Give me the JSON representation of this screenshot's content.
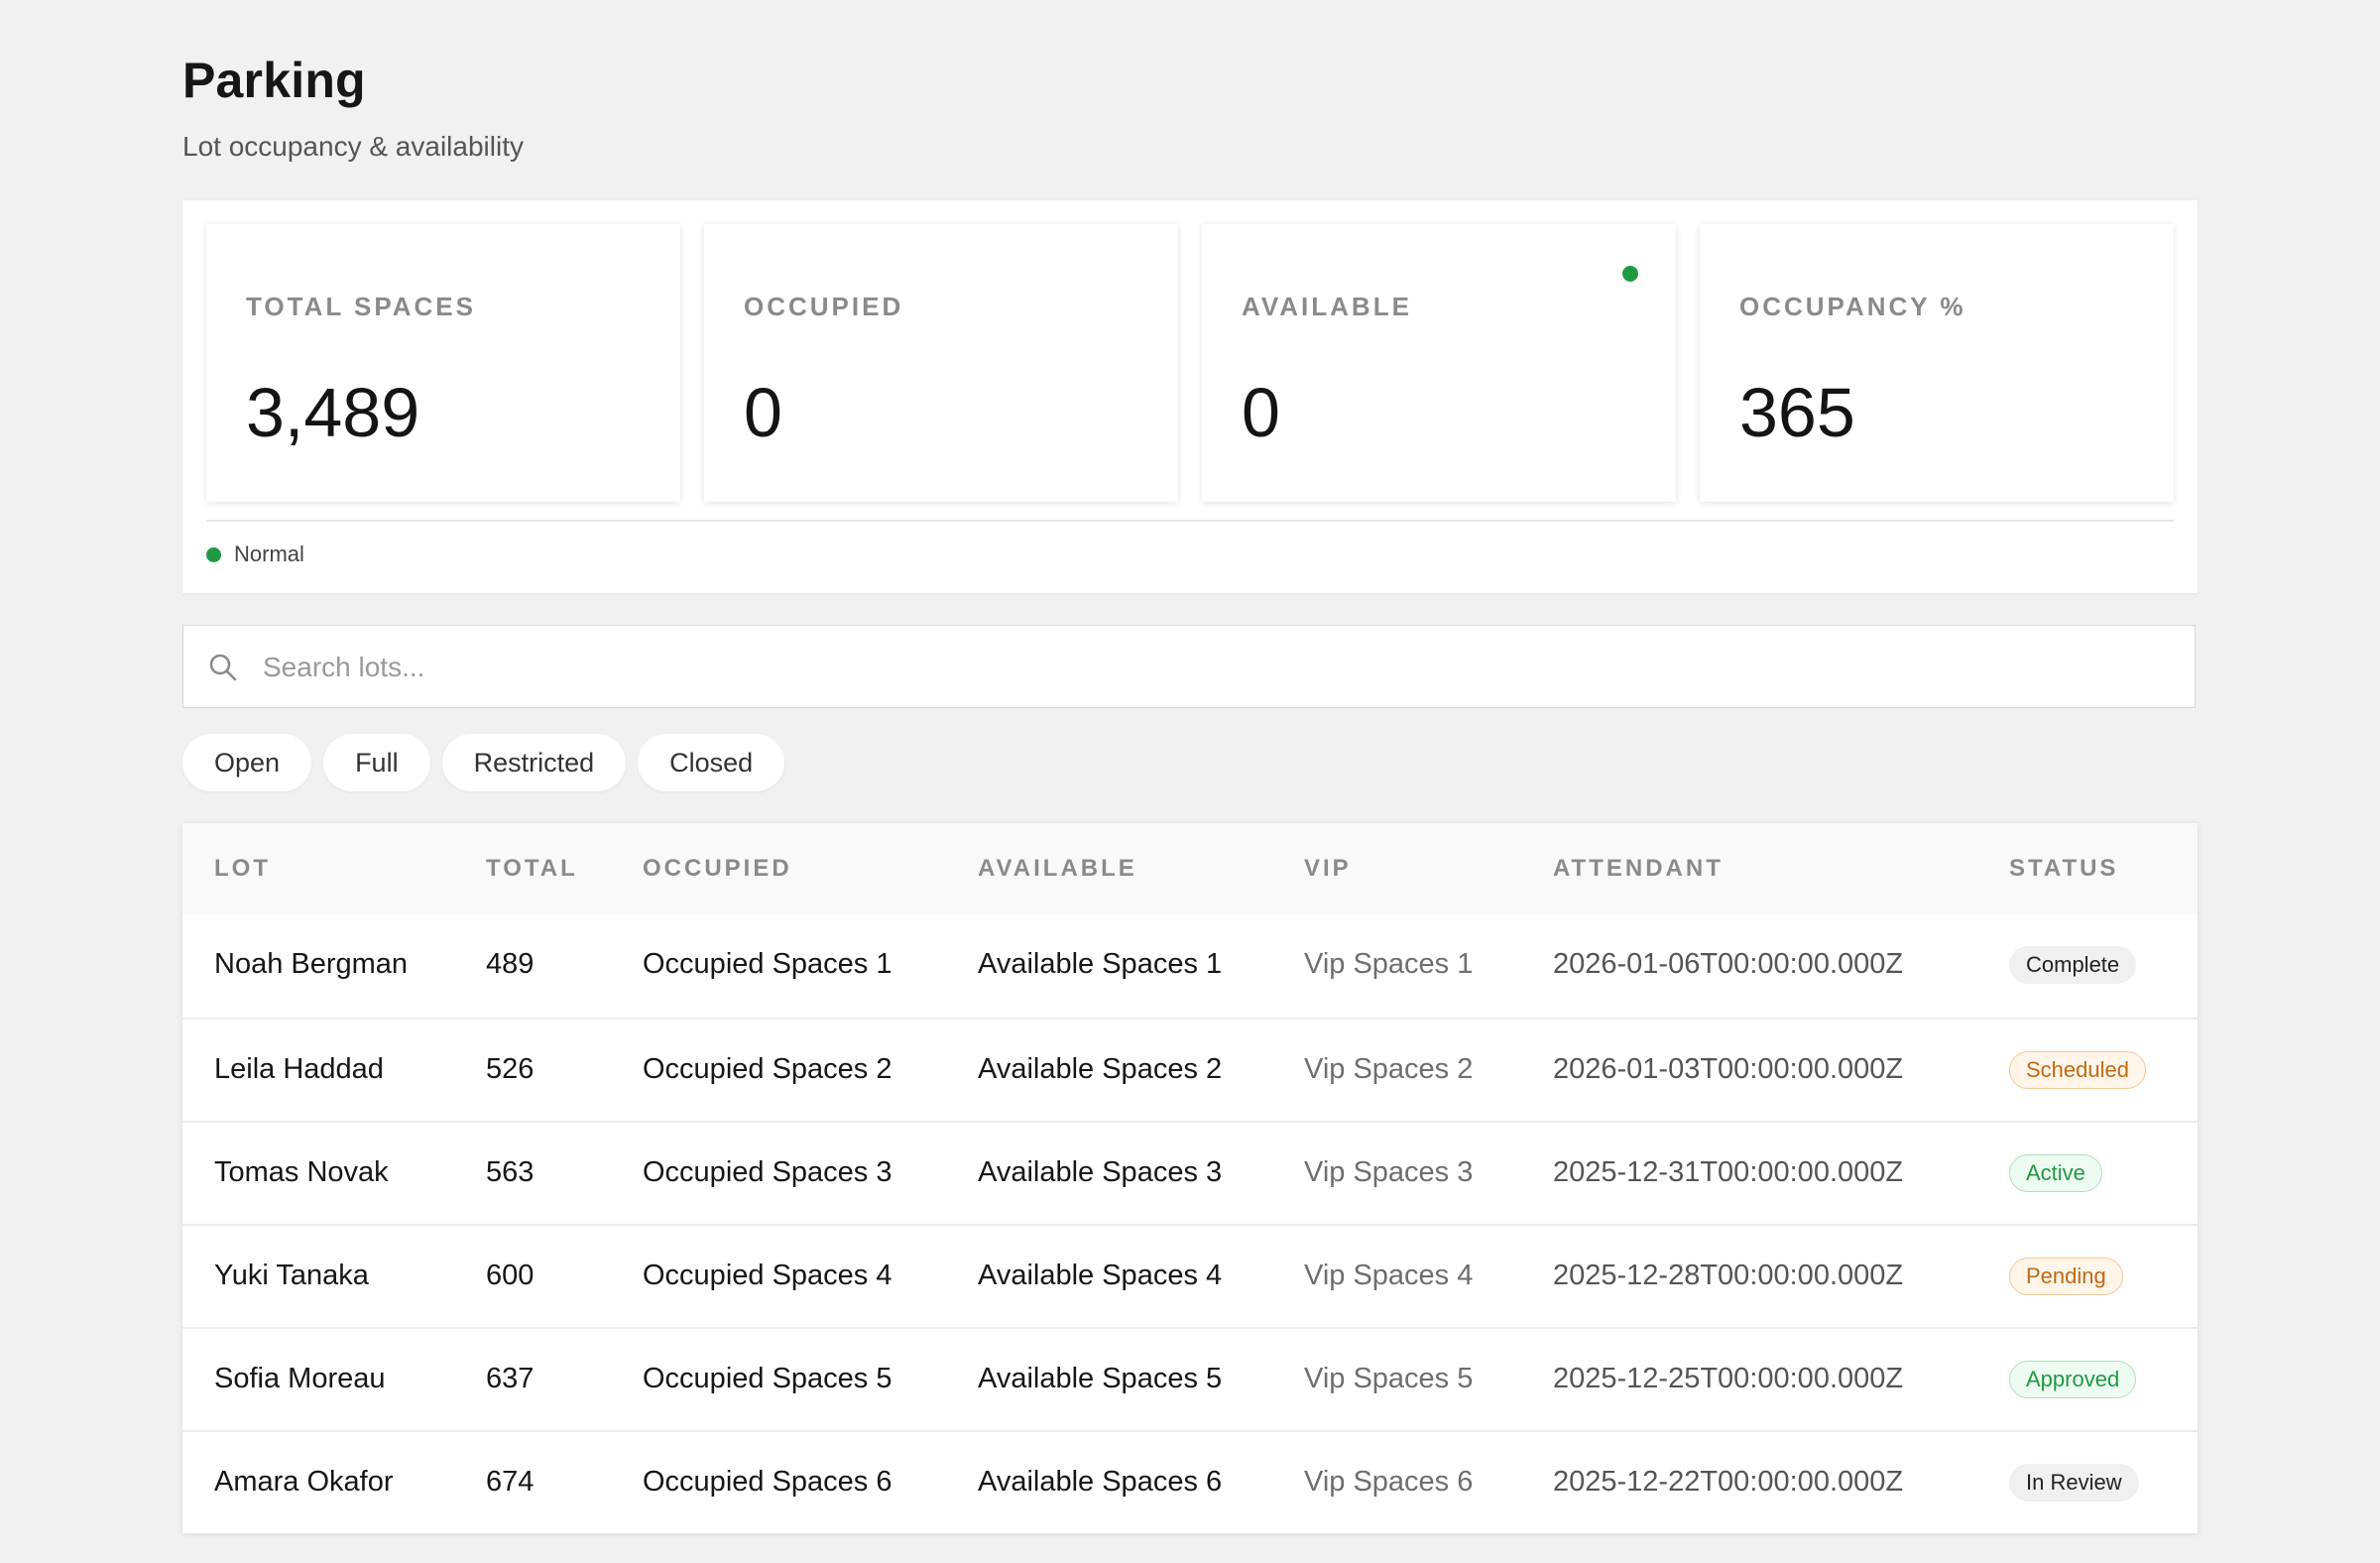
{
  "header": {
    "title": "Parking",
    "subtitle": "Lot occupancy & availability"
  },
  "stats": [
    {
      "label": "TOTAL SPACES",
      "value": "3,489",
      "indicator": false
    },
    {
      "label": "OCCUPIED",
      "value": "0",
      "indicator": false
    },
    {
      "label": "AVAILABLE",
      "value": "0",
      "indicator": true
    },
    {
      "label": "OCCUPANCY %",
      "value": "365",
      "indicator": false
    }
  ],
  "status": {
    "label": "Normal",
    "color": "#1f9a43"
  },
  "search": {
    "placeholder": "Search lots...",
    "value": ""
  },
  "filters": [
    "Open",
    "Full",
    "Restricted",
    "Closed"
  ],
  "table": {
    "columns": [
      "LOT",
      "TOTAL",
      "OCCUPIED",
      "AVAILABLE",
      "VIP",
      "ATTENDANT",
      "STATUS"
    ],
    "rows": [
      {
        "lot": "Noah Bergman",
        "total": "489",
        "occupied": "Occupied Spaces 1",
        "available": "Available Spaces 1",
        "vip": "Vip Spaces 1",
        "attendant": "2026-01-06T00:00:00.000Z",
        "status": "Complete",
        "status_style": "neutral"
      },
      {
        "lot": "Leila Haddad",
        "total": "526",
        "occupied": "Occupied Spaces 2",
        "available": "Available Spaces 2",
        "vip": "Vip Spaces 2",
        "attendant": "2026-01-03T00:00:00.000Z",
        "status": "Scheduled",
        "status_style": "warning"
      },
      {
        "lot": "Tomas Novak",
        "total": "563",
        "occupied": "Occupied Spaces 3",
        "available": "Available Spaces 3",
        "vip": "Vip Spaces 3",
        "attendant": "2025-12-31T00:00:00.000Z",
        "status": "Active",
        "status_style": "success"
      },
      {
        "lot": "Yuki Tanaka",
        "total": "600",
        "occupied": "Occupied Spaces 4",
        "available": "Available Spaces 4",
        "vip": "Vip Spaces 4",
        "attendant": "2025-12-28T00:00:00.000Z",
        "status": "Pending",
        "status_style": "warning"
      },
      {
        "lot": "Sofia Moreau",
        "total": "637",
        "occupied": "Occupied Spaces 5",
        "available": "Available Spaces 5",
        "vip": "Vip Spaces 5",
        "attendant": "2025-12-25T00:00:00.000Z",
        "status": "Approved",
        "status_style": "success"
      },
      {
        "lot": "Amara Okafor",
        "total": "674",
        "occupied": "Occupied Spaces 6",
        "available": "Available Spaces 6",
        "vip": "Vip Spaces 6",
        "attendant": "2025-12-22T00:00:00.000Z",
        "status": "In Review",
        "status_style": "neutral"
      }
    ]
  },
  "colors": {
    "accent_green": "#1f9a43",
    "background": "#f1f1f1"
  }
}
